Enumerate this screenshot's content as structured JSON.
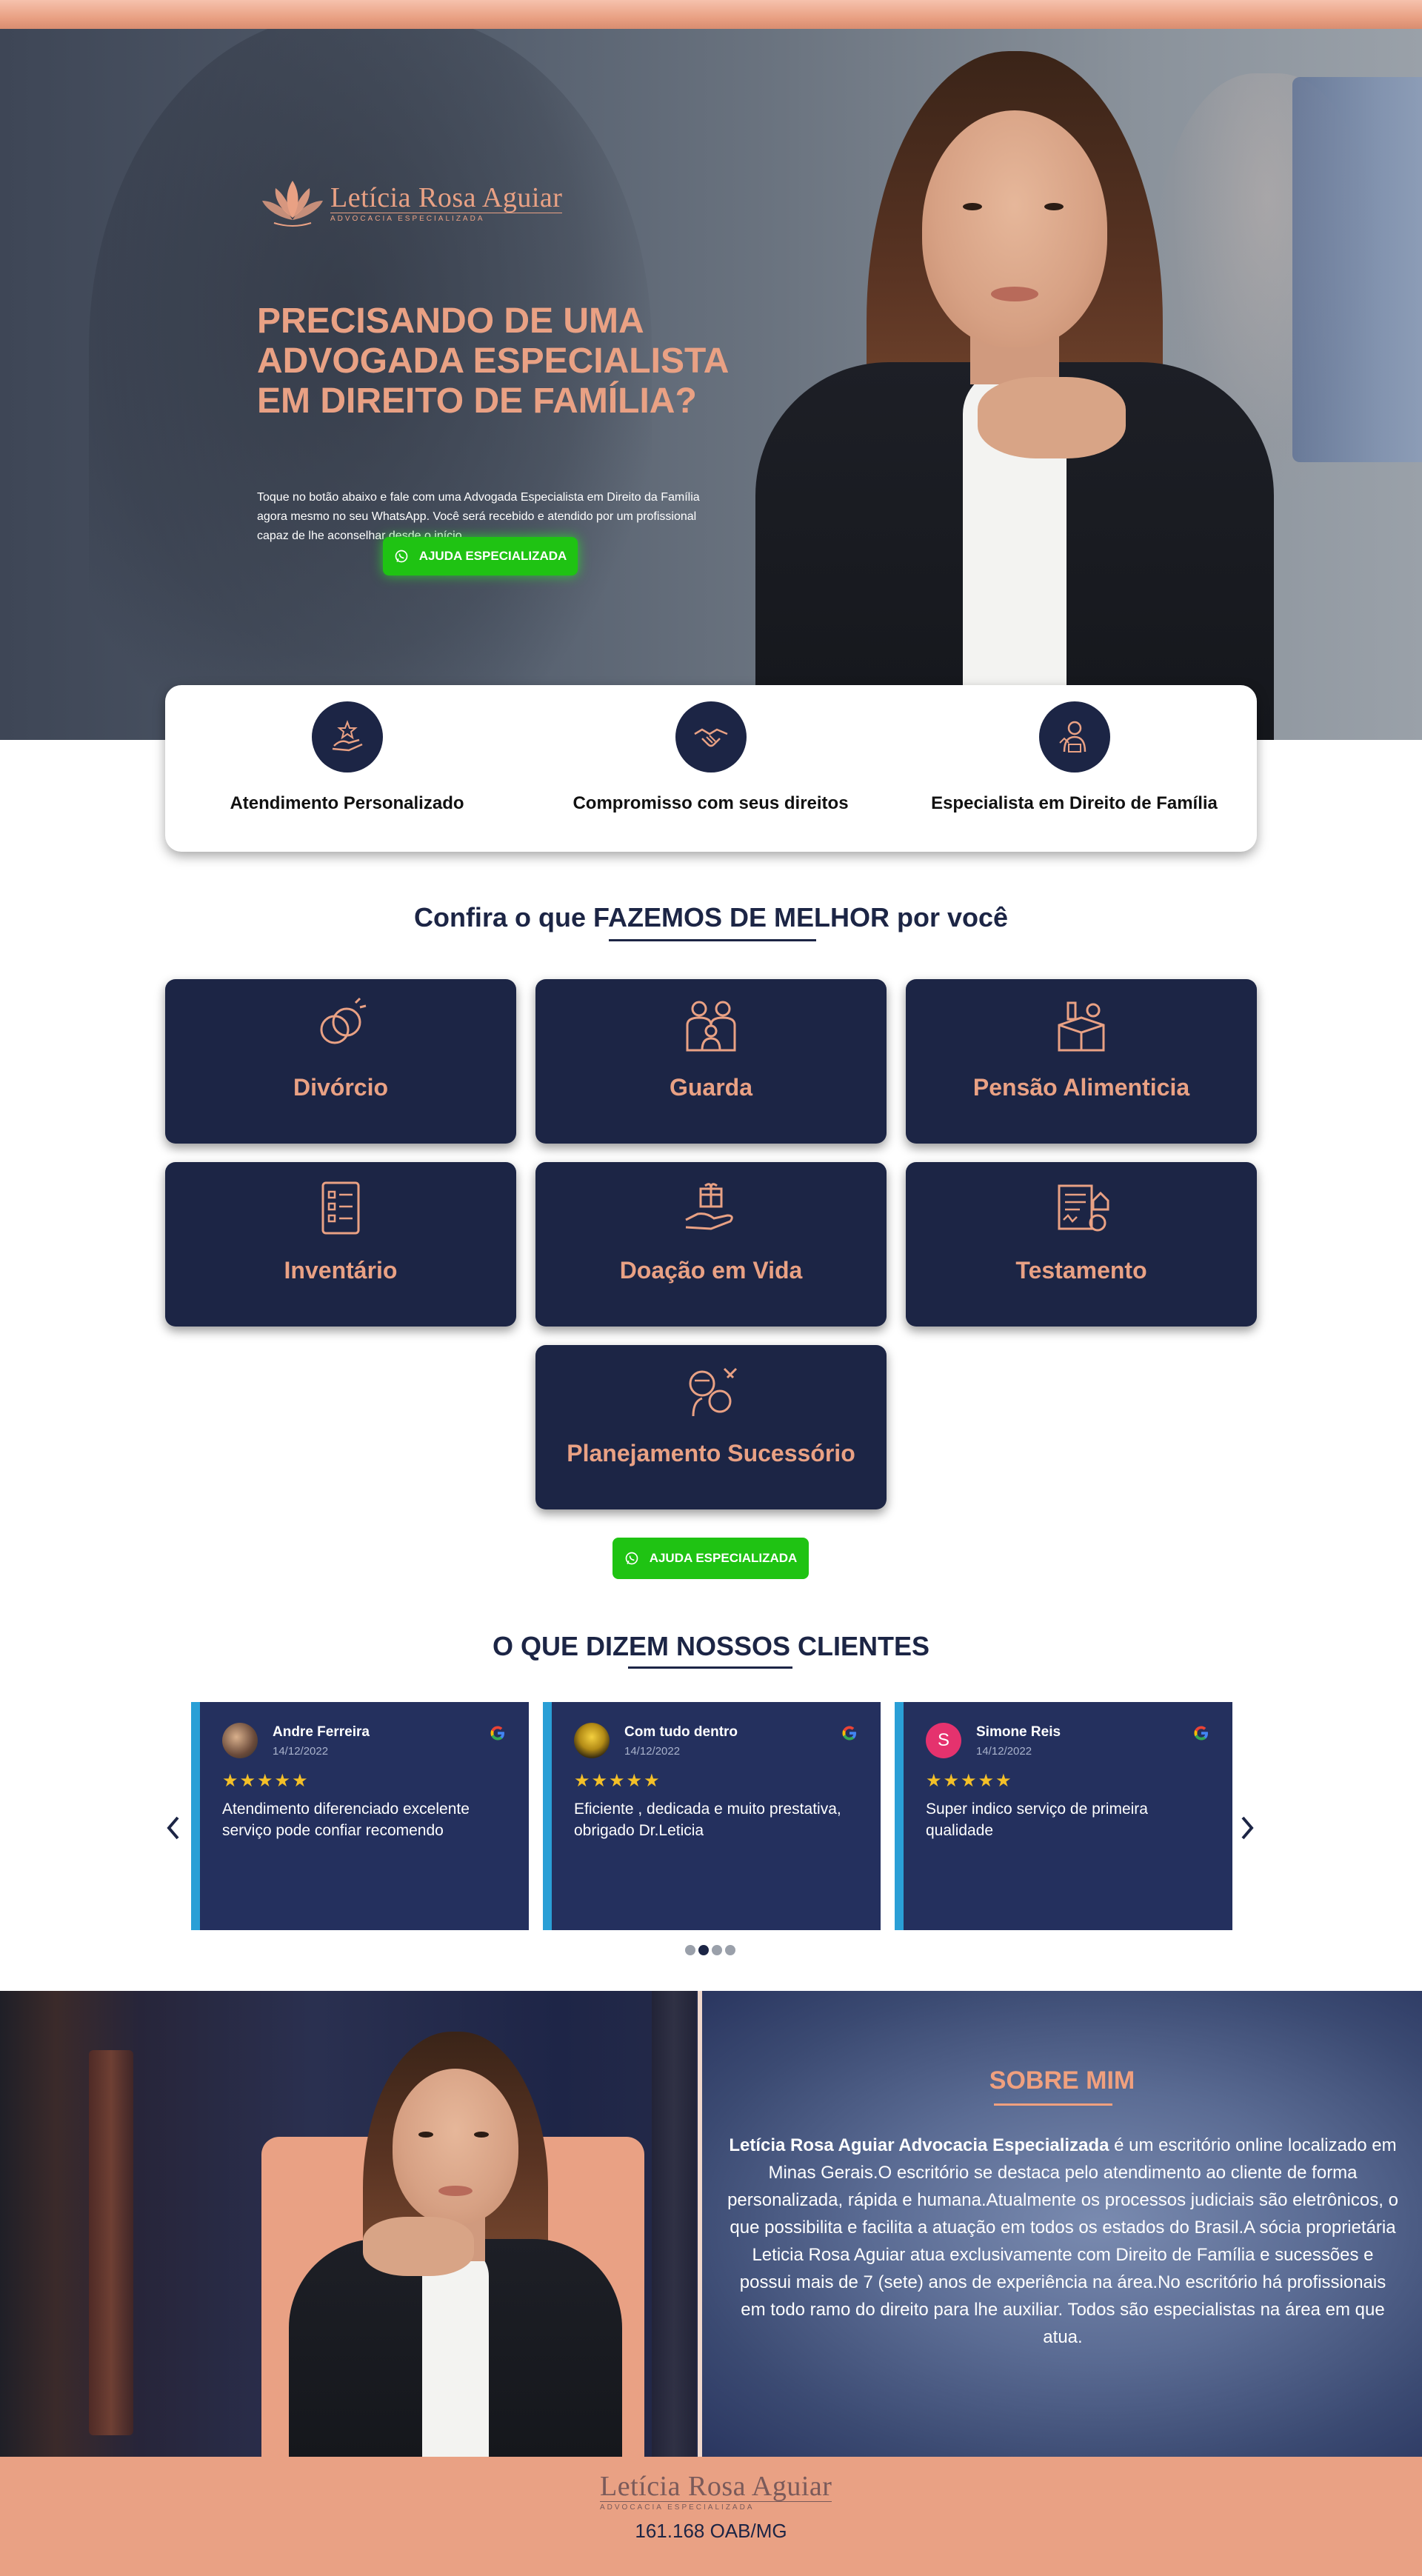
{
  "brand": {
    "name": "Letícia Rosa Aguiar",
    "tagline": "ADVOCACIA ESPECIALIZADA",
    "color": "#e9a184",
    "navy": "#1c2545",
    "whatsapp_green": "#1fc313"
  },
  "hero": {
    "title": "PRECISANDO DE UMA ADVOGADA ESPECIALISTA EM DIREITO DE FAMÍLIA?",
    "description": "Toque no botão abaixo e fale com uma Advogada Especialista em Direito da Família agora mesmo no seu WhatsApp. Você será recebido e atendido por um profissional capaz de lhe aconselhar desde o início.",
    "cta_label": "AJUDA ESPECIALIZADA",
    "cta_icon": "whatsapp-icon"
  },
  "features": [
    {
      "label": "Atendimento Personalizado",
      "icon": "personal-service-icon"
    },
    {
      "label": "Compromisso com seus direitos",
      "icon": "handshake-icon"
    },
    {
      "label": "Especialista em Direito de Família",
      "icon": "lawyer-icon"
    }
  ],
  "services": {
    "title": "Confira o que FAZEMOS DE MELHOR por você",
    "items": [
      {
        "label": "Divórcio",
        "icon": "broken-rings-icon"
      },
      {
        "label": "Guarda",
        "icon": "family-icon"
      },
      {
        "label": "Pensão Alimenticia",
        "icon": "food-box-icon"
      },
      {
        "label": "Inventário",
        "icon": "checklist-icon"
      },
      {
        "label": "Doação em Vida",
        "icon": "gift-hand-icon"
      },
      {
        "label": "Testamento",
        "icon": "will-document-icon"
      },
      {
        "label": "Planejamento Sucessório",
        "icon": "succession-icon"
      }
    ],
    "cta_label": "AJUDA ESPECIALIZADA"
  },
  "testimonials": {
    "title": "O QUE DIZEM NOSSOS CLIENTES",
    "items": [
      {
        "name": "Andre Ferreira",
        "date": "14/12/2022",
        "rating": 5,
        "stars": "★★★★★",
        "text": "Atendimento diferenciado excelente serviço pode confiar recomendo"
      },
      {
        "name": "Com tudo dentro",
        "date": "14/12/2022",
        "rating": 5,
        "stars": "★★★★★",
        "text": "Eficiente , dedicada e muito prestativa, obrigado Dr.Leticia"
      },
      {
        "name": "Simone Reis",
        "date": "14/12/2022",
        "rating": 5,
        "stars": "★★★★★",
        "text": "Super indico serviço de primeira qualidade",
        "avatar_letter": "S"
      }
    ],
    "page_count": 4,
    "active_page": 2
  },
  "about": {
    "title": "SOBRE MIM",
    "text_bold": "Letícia Rosa Aguiar Advocacia Especializada",
    "text_rest": " é um escritório online localizado em Minas Gerais.O escritório se destaca pelo atendimento ao cliente de forma personalizada, rápida e humana.Atualmente os processos judiciais são eletrônicos, o que possibilita e facilita a atuação em todos os estados do Brasil.A sócia proprietária Leticia Rosa Aguiar atua exclusivamente com Direito de Família e sucessões e possui mais de 7 (sete) anos de experiência na área.No escritório há profissionais em todo ramo do direito para lhe auxiliar. Todos são especialistas na área em que atua."
  },
  "footer": {
    "oab": "161.168 OAB/MG"
  }
}
